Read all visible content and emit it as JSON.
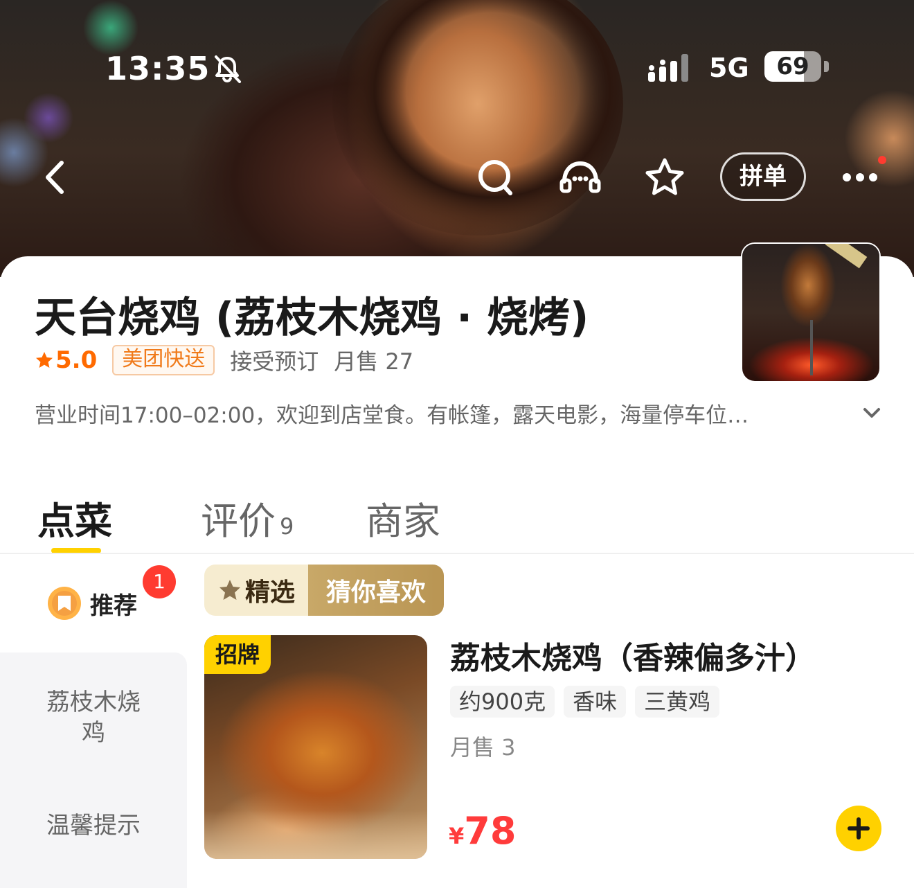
{
  "status_bar": {
    "time": "13:35",
    "network": "5G",
    "battery": "69",
    "battery_level_percent": 69,
    "icons": [
      "bell-slash-icon",
      "signal-icon"
    ]
  },
  "top_nav": {
    "icons": [
      "back-icon",
      "search-icon",
      "chat-icon",
      "star-icon",
      "more-icon"
    ],
    "group_order_label": "拼单"
  },
  "store": {
    "name": "天台烧鸡 (荔枝木烧鸡 · 烧烤)",
    "rating": "5.0",
    "delivery_tag": "美团快送",
    "reservation": "接受预订",
    "monthly_sales": "月售 27",
    "notice": "营业时间17:00–02:00，欢迎到店堂食。有帐篷，露天电影，海量停车位…"
  },
  "tabs": [
    {
      "label": "点菜",
      "count": "",
      "active": true
    },
    {
      "label": "评价",
      "count": "9",
      "active": false
    },
    {
      "label": "商家",
      "count": "",
      "active": false
    }
  ],
  "sidebar": {
    "recommend_label": "推荐",
    "recommend_badge": "1",
    "items": [
      {
        "label": "荔枝木烧鸡"
      },
      {
        "label": "温馨提示"
      }
    ]
  },
  "section": {
    "featured_label": "精选",
    "guess_label": "猜你喜欢"
  },
  "dish": {
    "badge": "招牌",
    "title": "荔枝木烧鸡（香辣偏多汁）",
    "tags": [
      "约900克",
      "香味",
      "三黄鸡"
    ],
    "sales": "月售 3",
    "currency": "¥",
    "price": "78"
  },
  "colors": {
    "accent_yellow": "#ffd100",
    "price_red": "#ff3b3b",
    "rating_orange": "#ff6a00",
    "badge_red": "#ff3b30"
  }
}
